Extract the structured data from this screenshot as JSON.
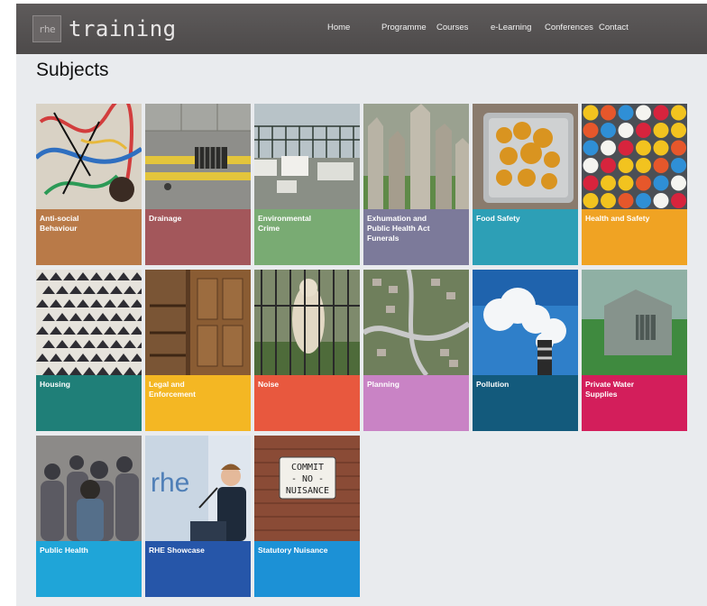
{
  "header": {
    "logo_mark": "rhe",
    "logo_word": "training",
    "nav": [
      {
        "label": "Home"
      },
      {
        "label": "Programme"
      },
      {
        "label": "Courses"
      },
      {
        "label": "e-Learning"
      },
      {
        "label": "Conferences"
      },
      {
        "label": "Contact"
      }
    ]
  },
  "page_title": "Subjects",
  "tiles": [
    {
      "label": "Anti-social\nBehaviour",
      "color": "#b97a48",
      "image": "graffiti-photo"
    },
    {
      "label": "Drainage",
      "color": "#a3575b",
      "image": "drain-grate-photo"
    },
    {
      "label": "Environmental\nCrime",
      "color": "#79ab73",
      "image": "fly-tipping-photo"
    },
    {
      "label": "Exhumation and\nPublic Health Act\nFunerals",
      "color": "#7c7a9a",
      "image": "gravestones-photo"
    },
    {
      "label": "Food Safety",
      "color": "#2d9fb6",
      "image": "food-tray-photo"
    },
    {
      "label": "Health and Safety",
      "color": "#f0a323",
      "image": "hard-hats-photo"
    },
    {
      "label": "Housing",
      "color": "#1f7f78",
      "image": "housing-aerial-photo"
    },
    {
      "label": "Legal and\nEnforcement",
      "color": "#f4b723",
      "image": "courtroom-photo"
    },
    {
      "label": "Noise",
      "color": "#e8583e",
      "image": "bear-cage-photo"
    },
    {
      "label": "Planning",
      "color": "#c983c5",
      "image": "estate-aerial-photo"
    },
    {
      "label": "Pollution",
      "color": "#135a7c",
      "image": "chimney-smoke-photo"
    },
    {
      "label": "Private Water\nSupplies",
      "color": "#d31e5b",
      "image": "well-house-photo"
    },
    {
      "label": "Public Health",
      "color": "#1fa5d8",
      "image": "crowd-photo"
    },
    {
      "label": "RHE Showcase",
      "color": "#2656a9",
      "image": "speaker-photo",
      "image_text": "rhe"
    },
    {
      "label": "Statutory Nuisance",
      "color": "#1c91d6",
      "image": "nuisance-sign-photo",
      "image_text": "COMMIT\n- NO -\nNUISANCE"
    }
  ]
}
